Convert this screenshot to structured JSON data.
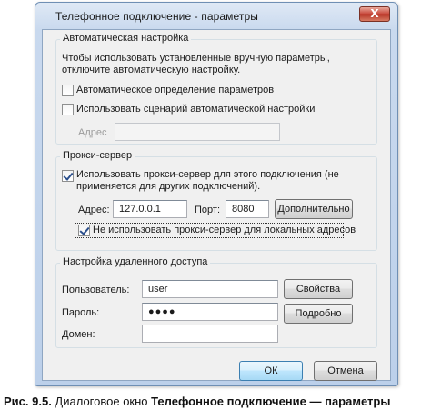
{
  "window": {
    "title": "Телефонное подключение - параметры",
    "close_symbol": "X"
  },
  "auto_config": {
    "legend": "Автоматическая настройка",
    "description_line1": "Чтобы использовать установленные вручную параметры,",
    "description_line2": "отключите автоматическую настройку.",
    "auto_detect": {
      "label": "Автоматическое определение параметров",
      "checked": false
    },
    "use_script": {
      "label": "Использовать сценарий автоматической настройки",
      "checked": false
    },
    "address_label": "Адрес",
    "address_value": ""
  },
  "proxy": {
    "legend": "Прокси-сервер",
    "use_proxy_line1": "Использовать прокси-сервер для этого подключения (не",
    "use_proxy_line2": "применяется для других подключений).",
    "use_proxy_checked": true,
    "address_label": "Адрес:",
    "address_value": "127.0.0.1",
    "port_label": "Порт:",
    "port_value": "8080",
    "advanced_button": "Дополнительно",
    "bypass_local": {
      "label": "Не использовать прокси-сервер для локальных адресов",
      "checked": true
    }
  },
  "remote": {
    "legend": "Настройка удаленного доступа",
    "user_label": "Пользователь:",
    "user_value": "user",
    "password_label": "Пароль:",
    "password_value": "●●●●",
    "domain_label": "Домен:",
    "domain_value": "",
    "properties_button": "Свойства",
    "details_button": "Подробно"
  },
  "footer": {
    "ok_button": "ОК",
    "cancel_button": "Отмена"
  },
  "caption": {
    "prefix": "Рис. 9.5.",
    "text": " Диалоговое окно ",
    "bold": "Телефонное подключение — параметры"
  }
}
